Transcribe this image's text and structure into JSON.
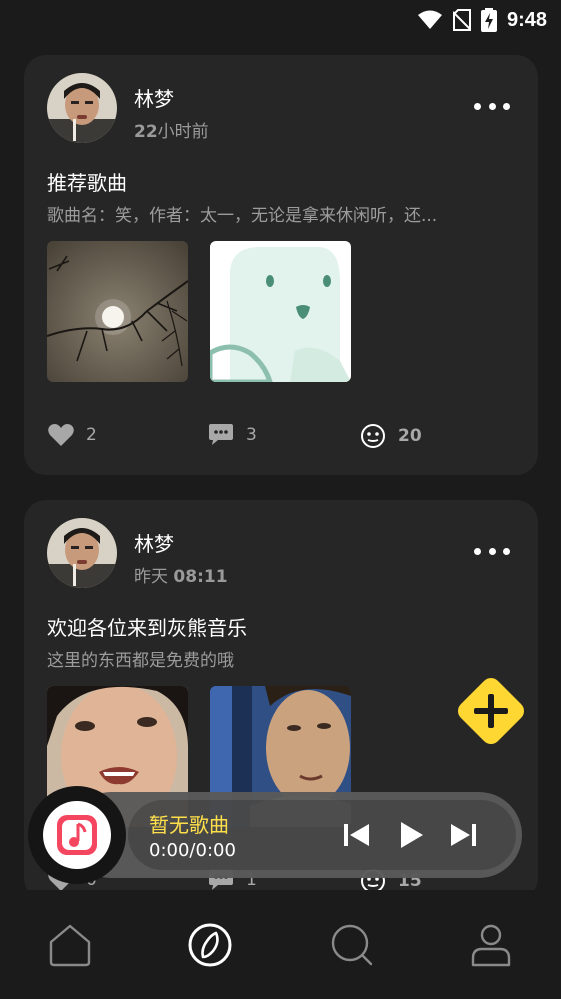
{
  "status_bar": {
    "time": "9:48"
  },
  "posts": [
    {
      "author": "林梦",
      "time_prefix": "",
      "time_bold": "22",
      "time_suffix": "小时前",
      "title": "推荐歌曲",
      "description": "歌曲名：笑，作者：太一，无论是拿来休闲听，还...",
      "likes": "2",
      "comments": "3",
      "shares": "20"
    },
    {
      "author": "林梦",
      "time_prefix": "昨天 ",
      "time_bold": "08:11",
      "time_suffix": "",
      "title": "欢迎各位来到灰熊音乐",
      "description": "这里的东西都是免费的哦",
      "likes": "0",
      "comments": "1",
      "shares": "15"
    }
  ],
  "player": {
    "song_name": "暂无歌曲",
    "progress": "0:00/0:00"
  },
  "colors": {
    "accent": "#ffd733",
    "song_name": "#ffe04a",
    "card": "#262626",
    "background": "#1b1b1b"
  },
  "icons": {
    "status": [
      "wifi-icon",
      "no-sim-icon",
      "battery-charging-icon"
    ],
    "actions": [
      "heart-icon",
      "comment-icon",
      "smile-icon"
    ],
    "player": [
      "music-note-icon",
      "previous-icon",
      "play-icon",
      "next-icon"
    ],
    "nav": [
      "home-icon",
      "discover-icon",
      "search-icon",
      "profile-icon"
    ],
    "fab": "add-icon"
  }
}
